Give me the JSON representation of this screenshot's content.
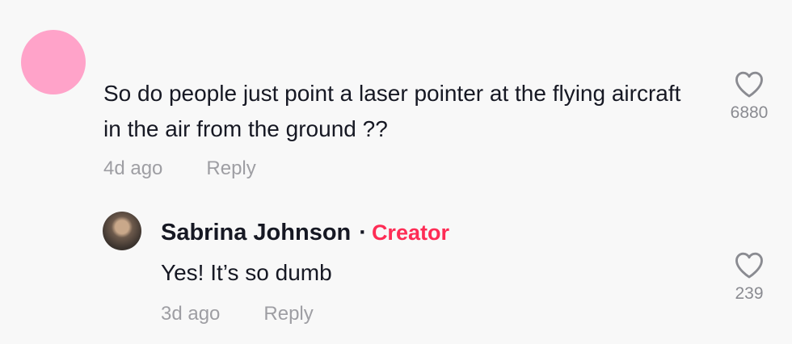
{
  "comment": {
    "text": "So do people just point a laser pointer at the flying aircraft in the air from the ground ??",
    "time": "4d ago",
    "reply_label": "Reply",
    "like_count": "6880",
    "avatar_color": "#ffa3c9"
  },
  "reply": {
    "author": "Sabrina Johnson",
    "separator": "·",
    "badge": "Creator",
    "badge_color": "#fe2c55",
    "text": "Yes! It’s so dumb",
    "time": "3d ago",
    "reply_label": "Reply",
    "like_count": "239"
  },
  "icons": {
    "like": "heart-outline-icon"
  }
}
